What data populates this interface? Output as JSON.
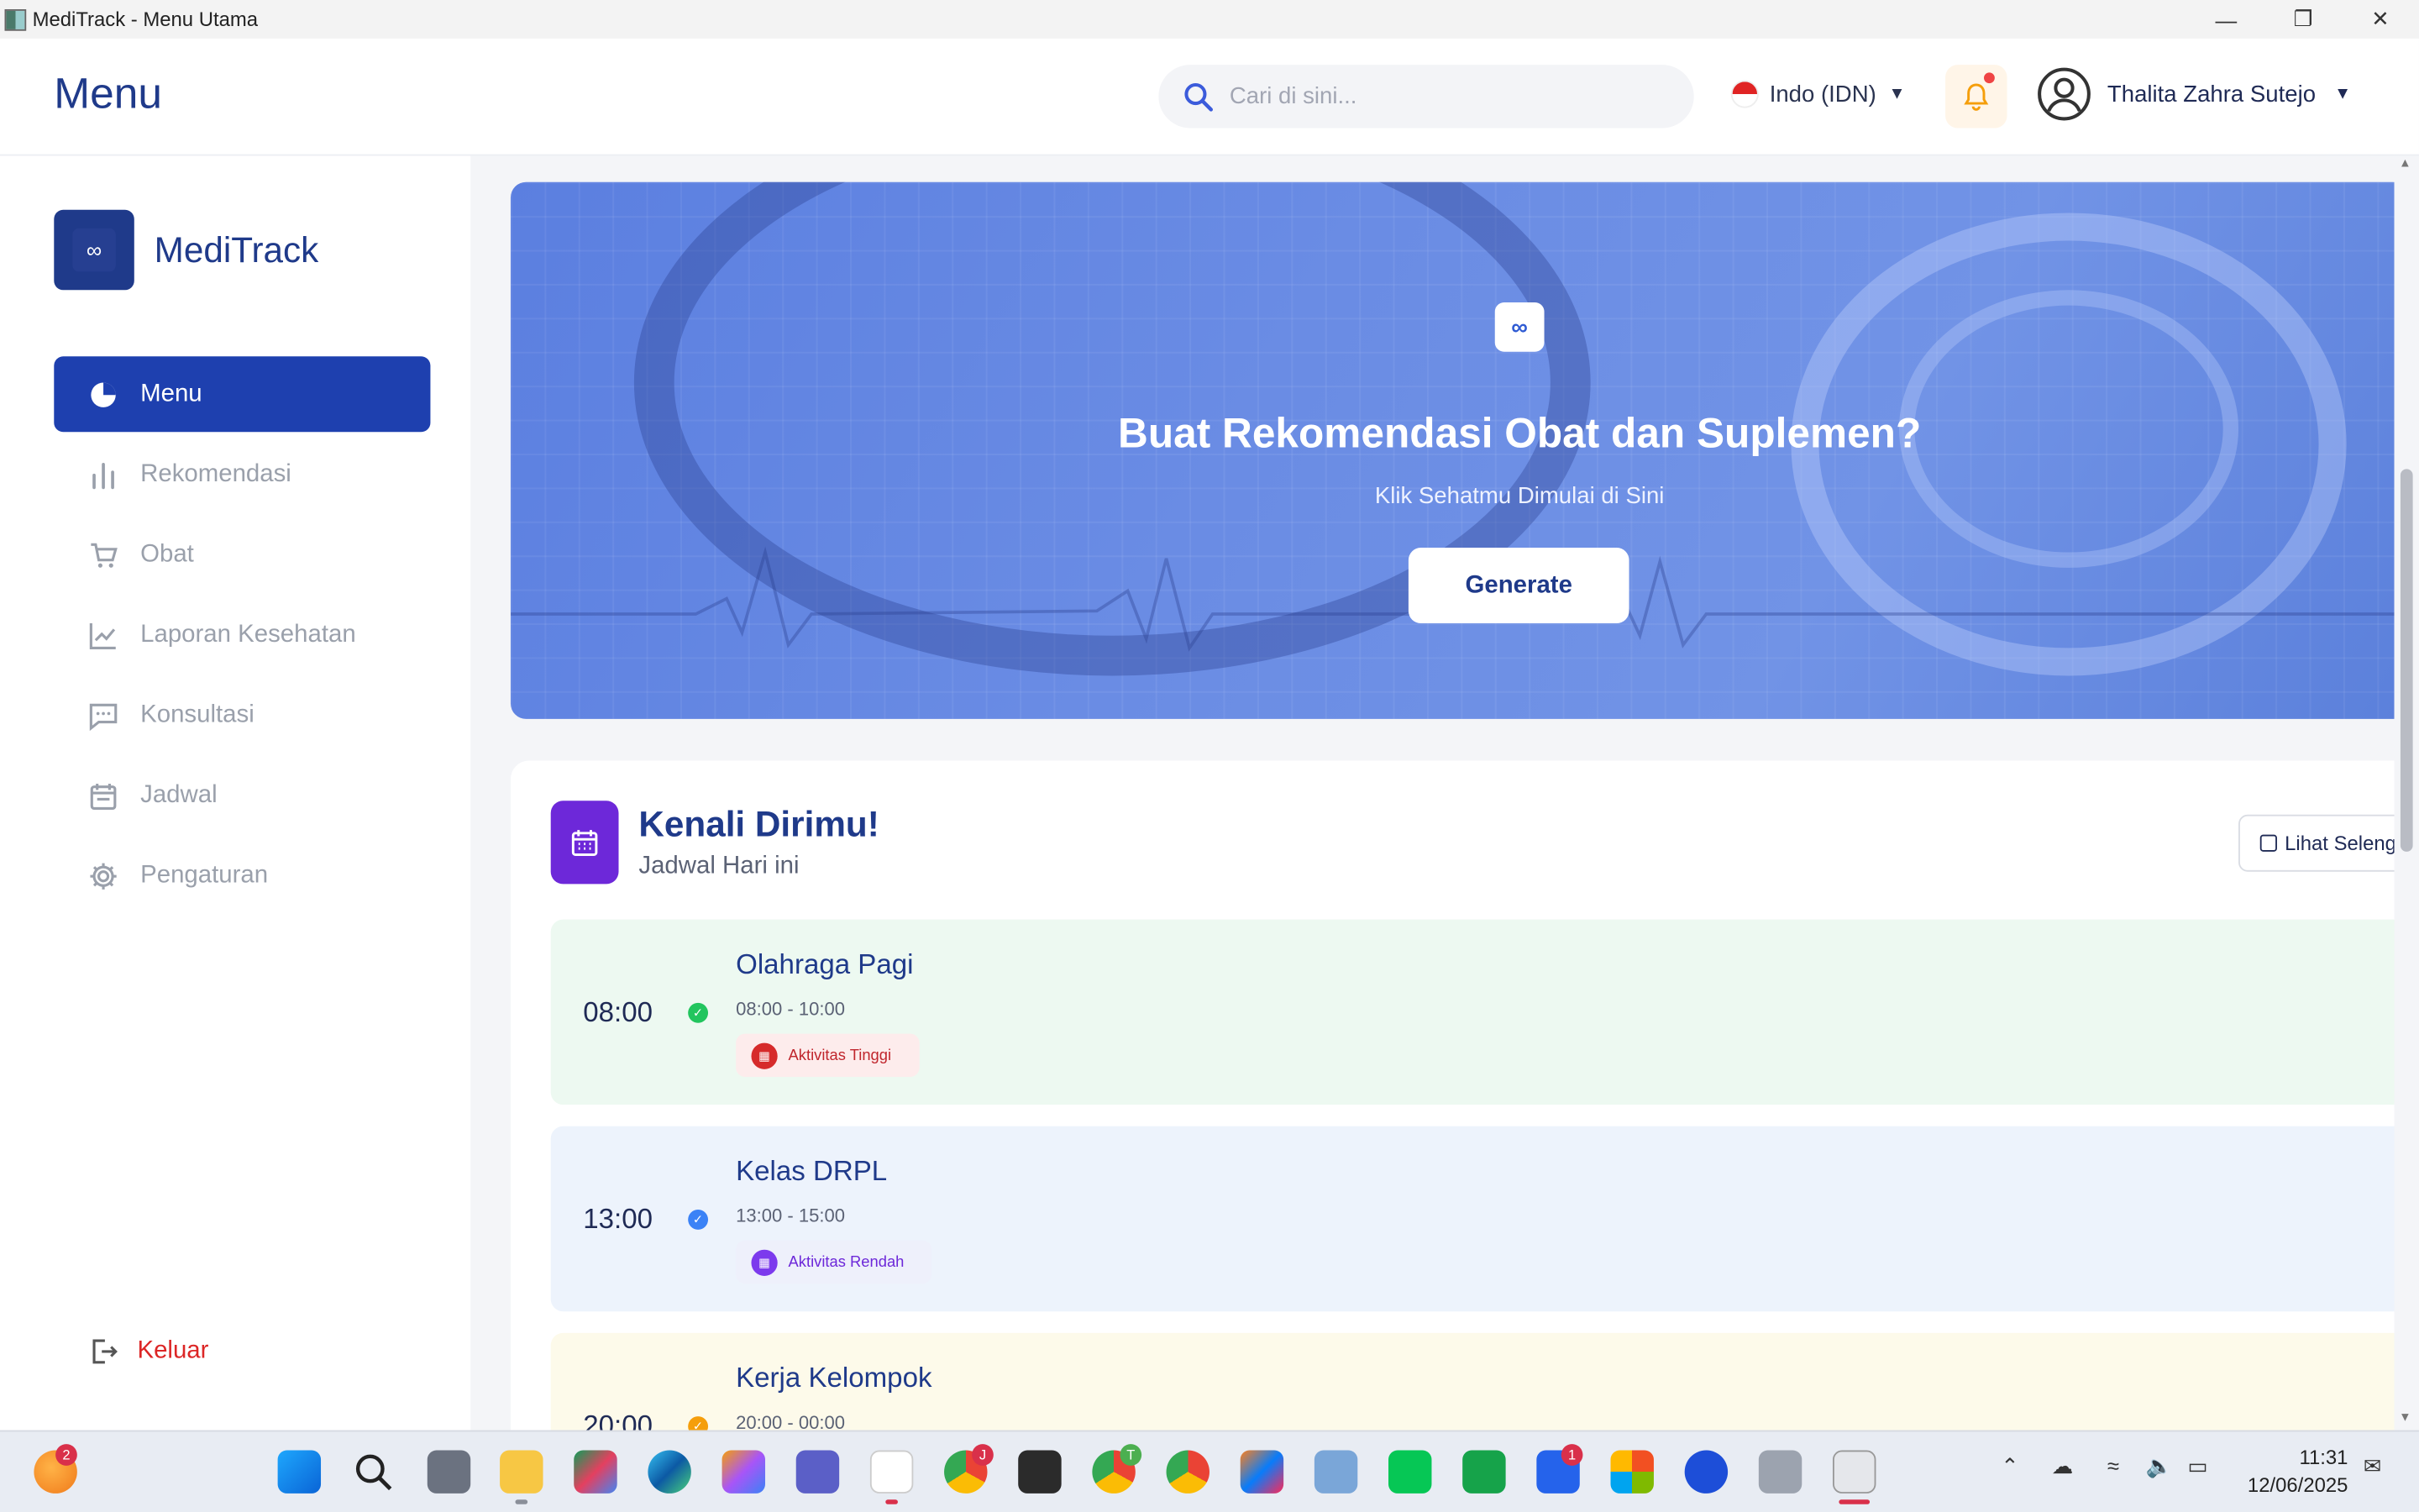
{
  "window": {
    "title": "MediTrack - Menu Utama"
  },
  "header": {
    "page_title": "Menu",
    "search_placeholder": "Cari di sini...",
    "language": "Indo (IDN)",
    "user_name": "Thalita Zahra Sutejo"
  },
  "sidebar": {
    "brand": "MediTrack",
    "items": [
      {
        "label": "Menu",
        "icon": "pie-chart-icon",
        "active": true
      },
      {
        "label": "Rekomendasi",
        "icon": "bar-chart-icon"
      },
      {
        "label": "Obat",
        "icon": "cart-icon"
      },
      {
        "label": "Laporan Kesehatan",
        "icon": "line-chart-icon"
      },
      {
        "label": "Konsultasi",
        "icon": "chat-icon"
      },
      {
        "label": "Jadwal",
        "icon": "calendar-icon"
      },
      {
        "label": "Pengaturan",
        "icon": "gear-icon"
      }
    ],
    "logout": "Keluar"
  },
  "hero": {
    "title": "Buat Rekomendasi Obat dan Suplemen?",
    "subtitle": "Klik Sehatmu Dimulai di Sini",
    "button": "Generate"
  },
  "schedule_card": {
    "title": "Kenali Dirimu!",
    "subtitle": "Jadwal Hari ini",
    "see_all": "Lihat Seleng",
    "items": [
      {
        "time": "08:00",
        "title": "Olahraga Pagi",
        "range": "08:00 - 10:00",
        "tag": "Aktivitas Tinggi",
        "bg": "#edf9f1",
        "dot": "#22c55e",
        "tag_bg": "#fdecec",
        "tag_color": "#c0262d",
        "tag_icon_bg": "#d62b2b"
      },
      {
        "time": "13:00",
        "title": "Kelas DRPL",
        "range": "13:00 - 15:00",
        "tag": "Aktivitas Rendah",
        "bg": "#edf3fc",
        "dot": "#3b82f6",
        "tag_bg": "#eef0fb",
        "tag_color": "#6d28d9",
        "tag_icon_bg": "#7c3aed"
      },
      {
        "time": "20:00",
        "title": "Kerja Kelompok",
        "range": "20:00 - 00:00",
        "tag": "",
        "bg": "#fdfaea",
        "dot": "#f59e0b"
      }
    ]
  },
  "taskbar": {
    "time": "11:31",
    "date": "12/06/2025",
    "badges": {
      "weather": "2",
      "chrome1": "J",
      "chrome2": "T",
      "app": "1"
    }
  },
  "colors": {
    "primary": "#1e40af",
    "logout": "#dc2626",
    "accent_purple": "#6d28d9"
  }
}
